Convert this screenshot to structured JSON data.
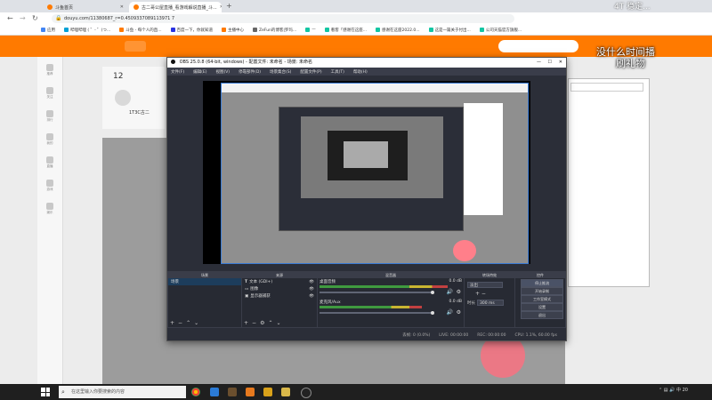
{
  "browser": {
    "tabs": [
      {
        "title": "斗鱼首页",
        "active": false,
        "color": "#ff7a00"
      },
      {
        "title": "古二哥公屋直播_看游戏解说直播_斗...",
        "active": true,
        "color": "#ff7a00"
      }
    ],
    "new_tab_label": "+",
    "url": "douyu.com/11380687_r=0.4509337089113971 7",
    "bookmarks": [
      {
        "label": "应用",
        "color": "#4285f4"
      },
      {
        "label": "哔哩哔哩 ( ゜- ゜)つ...",
        "color": "#00a1d6"
      },
      {
        "label": "斗鱼 - 每个人的直...",
        "color": "#ff7a00"
      },
      {
        "label": "百度一下，你就知道",
        "color": "#2932e1"
      },
      {
        "label": "主播中心",
        "color": "#ff7a00"
      },
      {
        "label": "ZeFun的博客|罗玛...",
        "color": "#666666"
      },
      {
        "label": "—",
        "color": "#13c6a3"
      },
      {
        "label": "看客「感谢在这座...",
        "color": "#13c6a3"
      },
      {
        "label": "感谢在这座2022.0...",
        "color": "#13c6a3"
      },
      {
        "label": "这是一篇关于付出...",
        "color": "#13c6a3"
      },
      {
        "label": "公司天猫官方旗舰...",
        "color": "#13c6a3"
      }
    ]
  },
  "site": {
    "left_nav": [
      "推荐",
      "关注",
      "排行",
      "我的",
      "直播",
      "游戏",
      "娱乐"
    ],
    "streamer_number": "12",
    "streamer_name": "1T3C古二",
    "overlay_top": "4T 稳定...",
    "overlay_text": [
      "没什么时间播",
      "刷礼物"
    ]
  },
  "obs": {
    "title": "OBS 25.0.8 (64-bit, windows) - 配置文件: 未命名 - 场景: 未命名",
    "menu": [
      "文件(F)",
      "编辑(E)",
      "视图(V)",
      "停靠部件(D)",
      "场景集合(S)",
      "配置文件(P)",
      "工具(T)",
      "帮助(H)"
    ],
    "docks": {
      "scenes": {
        "header": "场景",
        "items": [
          "场景"
        ]
      },
      "sources": {
        "header": "来源",
        "items": [
          "文本 (GDI+)",
          "图像",
          "显示器捕获"
        ]
      },
      "mixer": {
        "header": "混音器",
        "tracks": [
          {
            "name": "桌面音频",
            "db": "0.0 dB",
            "level": 0.9
          },
          {
            "name": "麦克风/Aux",
            "db": "0.0 dB",
            "level": 0.72
          }
        ]
      },
      "transitions": {
        "header": "转场特效",
        "type": "淡出",
        "duration_label": "时长",
        "duration": "300 ms"
      },
      "controls": {
        "header": "控件",
        "buttons": [
          "停止推流",
          "开始录制",
          "工作室模式",
          "设置",
          "退出"
        ]
      }
    },
    "status": {
      "dropped": "丢帧: 0 (0.0%)",
      "live": "LIVE: 00:00:00",
      "rec": "REC: 00:00:00",
      "cpu": "CPU: 1.1%, 60.00 fps"
    }
  },
  "taskbar": {
    "search_placeholder": "在这里输入你要搜索的内容",
    "clock": "20"
  }
}
